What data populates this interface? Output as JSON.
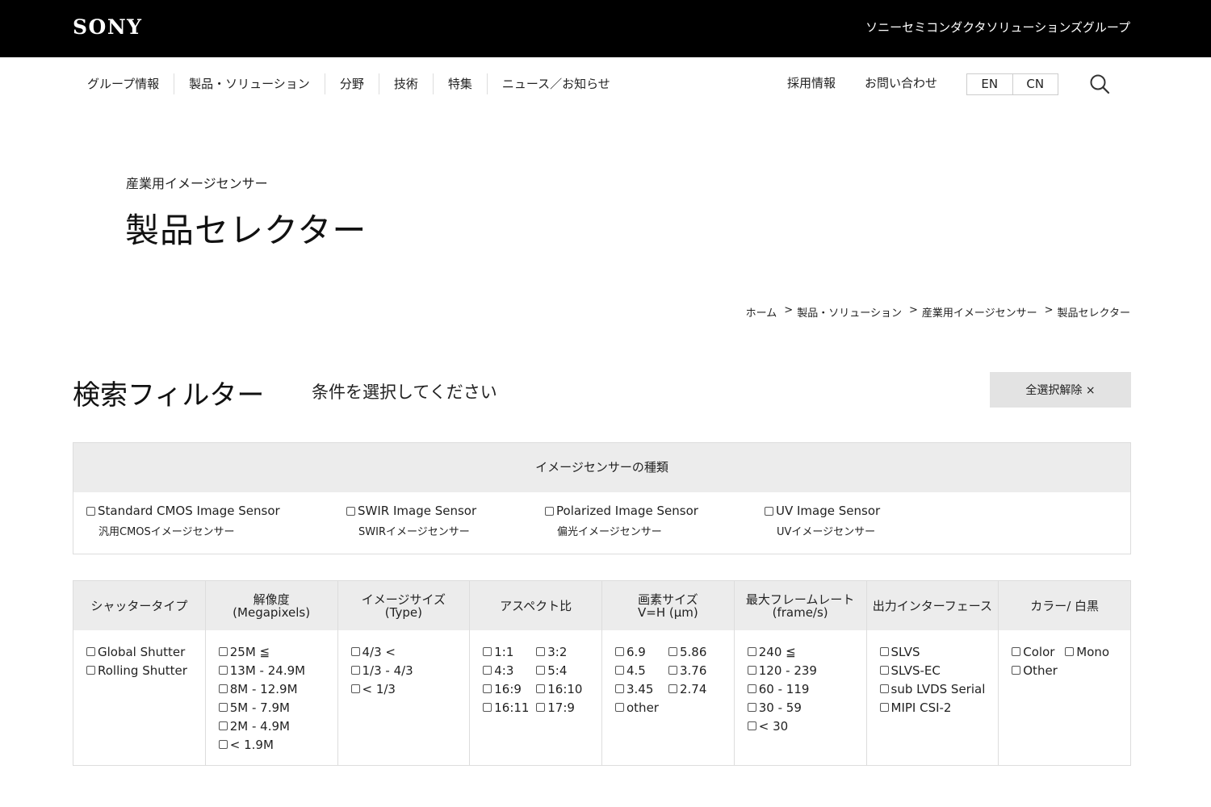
{
  "header": {
    "logo": "SONY",
    "group_name": "ソニーセミコンダクタソリューションズグループ"
  },
  "nav": {
    "items": [
      "グループ情報",
      "製品・ソリューション",
      "分野",
      "技術",
      "特集",
      "ニュース／お知らせ"
    ],
    "recruit": "採用情報",
    "contact": "お問い合わせ",
    "lang_en": "EN",
    "lang_cn": "CN",
    "search_icon": "search-icon"
  },
  "page": {
    "subtitle": "産業用イメージセンサー",
    "title": "製品セレクター"
  },
  "breadcrumb": {
    "sep": ">",
    "items": [
      "ホーム",
      "製品・ソリューション",
      "産業用イメージセンサー",
      "製品セレクター"
    ]
  },
  "filter": {
    "title": "検索フィルター",
    "prompt": "条件を選択してください",
    "clear_label": "全選択解除 ×"
  },
  "sensor_types": {
    "header": "イメージセンサーの種類",
    "options": [
      {
        "label": "Standard CMOS Image Sensor",
        "sub": "汎用CMOSイメージセンサー"
      },
      {
        "label": "SWIR Image Sensor",
        "sub": "SWIRイメージセンサー"
      },
      {
        "label": "Polarized Image Sensor",
        "sub": "偏光イメージセンサー"
      },
      {
        "label": "UV Image Sensor",
        "sub": "UVイメージセンサー"
      }
    ]
  },
  "columns": [
    {
      "head1": "シャッタータイプ",
      "head2": "",
      "options": [
        "Global Shutter",
        "Rolling Shutter"
      ]
    },
    {
      "head1": "解像度",
      "head2": "(Megapixels)",
      "options": [
        "25M ≦",
        "13M - 24.9M",
        "8M - 12.9M",
        "5M - 7.9M",
        "2M - 4.9M",
        "< 1.9M"
      ]
    },
    {
      "head1": "イメージサイズ",
      "head2": "(Type)",
      "options": [
        "4/3 <",
        "1/3 - 4/3",
        "< 1/3"
      ]
    },
    {
      "head1": "アスペクト比",
      "head2": "",
      "options": [
        "1:1",
        "3:2",
        "4:3",
        "5:4",
        "16:9",
        "16:10",
        "16:11",
        "17:9"
      ]
    },
    {
      "head1": "画素サイズ",
      "head2": "V=H (μm)",
      "options": [
        "6.9",
        "5.86",
        "4.5",
        "3.76",
        "3.45",
        "2.74",
        "other"
      ]
    },
    {
      "head1": "最大フレームレート",
      "head2": "(frame/s)",
      "options": [
        "240 ≦",
        "120 - 239",
        "60 - 119",
        "30 - 59",
        "< 30"
      ]
    },
    {
      "head1": "出力インターフェース",
      "head2": "",
      "options": [
        "SLVS",
        "SLVS-EC",
        "sub LVDS Serial",
        "MIPI CSI-2"
      ]
    },
    {
      "head1": "カラー/ 白黒",
      "head2": "",
      "options": [
        "Color",
        "Mono",
        "Other"
      ]
    }
  ]
}
